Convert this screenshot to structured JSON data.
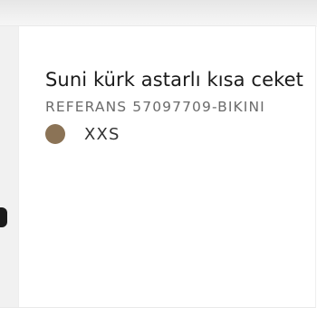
{
  "product": {
    "name": "Suni kürk astarlı kısa ceket",
    "reference": "REFERANS 57097709-BIKINI",
    "color_swatch": "#8b7356",
    "size": "XXS"
  }
}
